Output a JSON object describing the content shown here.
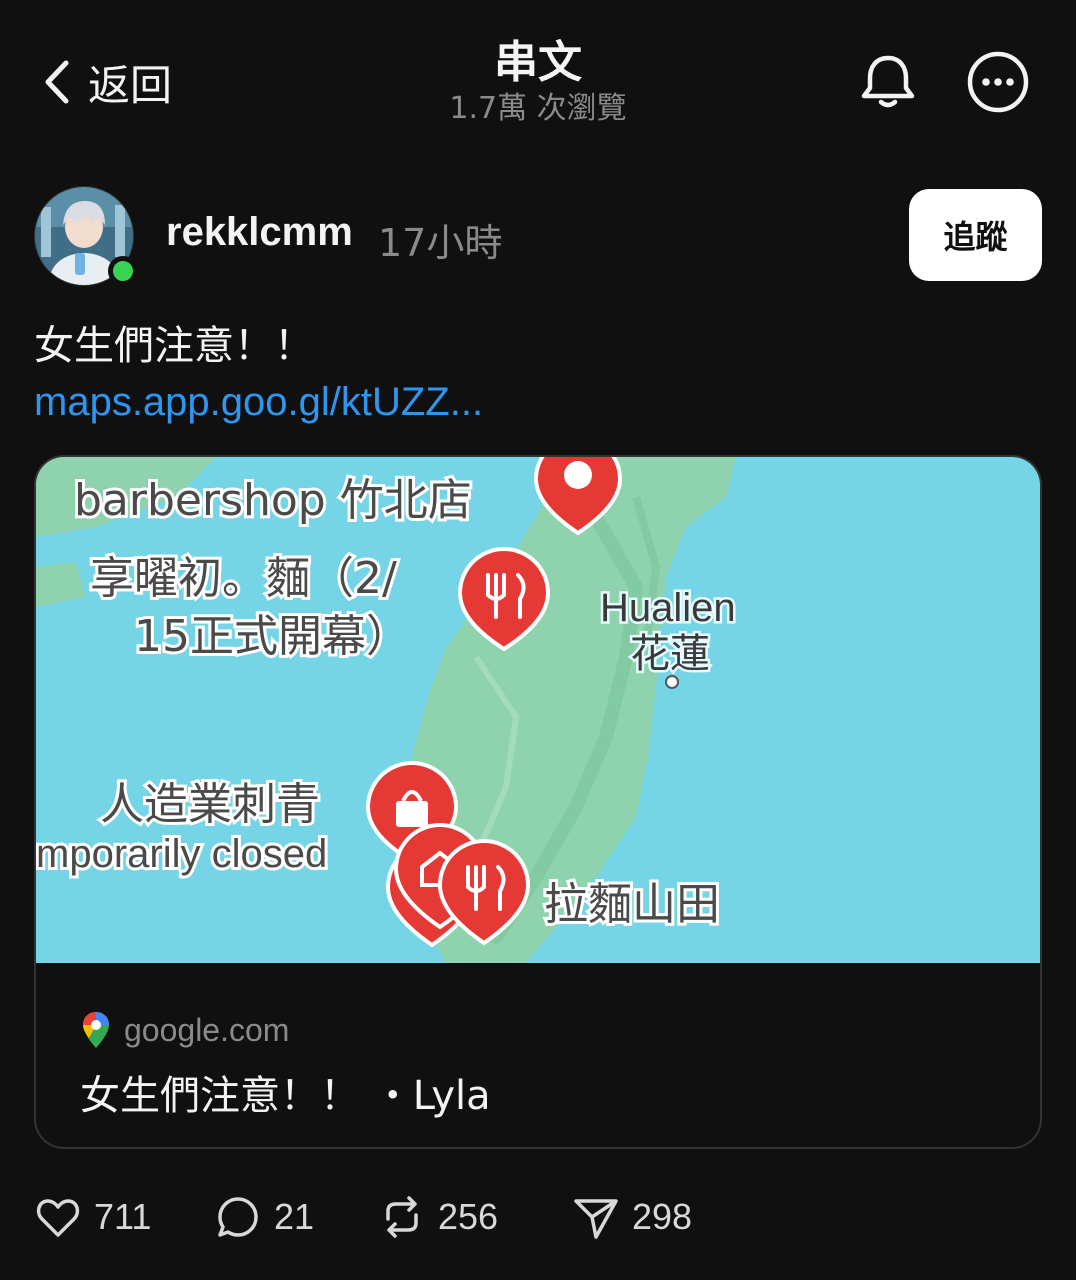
{
  "header": {
    "back_label": "返回",
    "title": "串文",
    "views": "1.7萬 次瀏覽"
  },
  "post": {
    "username": "rekklcmm",
    "time": "17小時",
    "follow_label": "追蹤",
    "text": "女生們注意！！",
    "link": "maps.app.goo.gl/ktUZZ..."
  },
  "card": {
    "domain": "google.com",
    "title": "女生們注意！！ ・Lyla",
    "map_labels": {
      "barbershop": "barbershop 竹北店",
      "noodle_line1": "享曜初。麵（2/",
      "noodle_line2": "15正式開幕）",
      "hualien_en": "Hualien",
      "hualien_zh": "花蓮",
      "tattoo": "人造業刺青",
      "closed": "mporarily closed",
      "ramen": "拉麵山田"
    }
  },
  "actions": {
    "likes": "711",
    "comments": "21",
    "reposts": "256",
    "shares": "298"
  },
  "colors": {
    "background": "#101010",
    "link": "#2f96f0",
    "online": "#39d353",
    "sea": "#75d4e6",
    "land": "#8fd3ae",
    "pin": "#e53935"
  }
}
